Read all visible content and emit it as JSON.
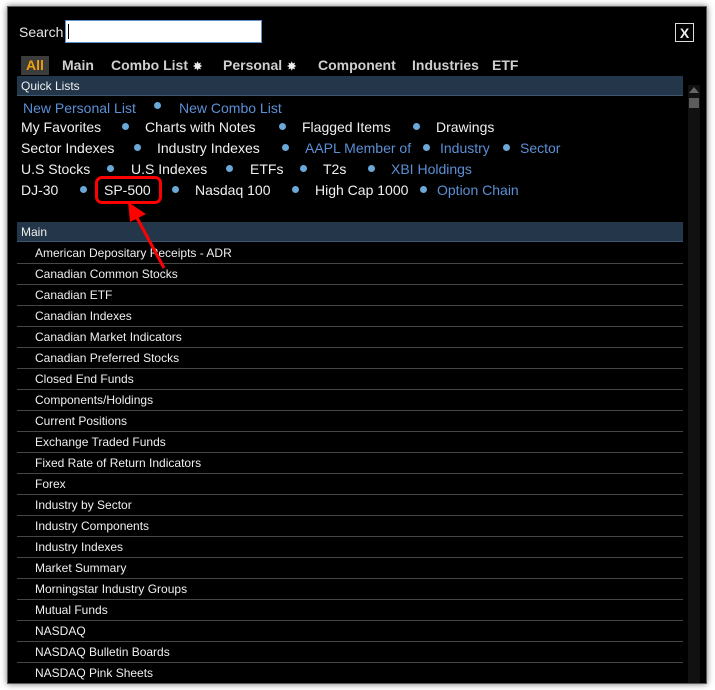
{
  "search": {
    "label": "Search",
    "value": ""
  },
  "close_label": "X",
  "tabs": [
    {
      "label": "All"
    },
    {
      "label": "Main"
    },
    {
      "label": "Combo List",
      "star": "✸"
    },
    {
      "label": "Personal",
      "star": "✸"
    },
    {
      "label": "Component"
    },
    {
      "label": "Industries"
    },
    {
      "label": "ETF"
    }
  ],
  "quick_lists": {
    "header": "Quick Lists",
    "rows": [
      [
        "New Personal List",
        "New Combo List"
      ],
      [
        "My Favorites",
        "Charts with Notes",
        "Flagged Items",
        "Drawings"
      ],
      [
        "Sector Indexes",
        "Industry Indexes",
        "AAPL Member of",
        "Industry",
        "Sector"
      ],
      [
        "U.S Stocks",
        "U.S Indexes",
        "ETFs",
        "T2s",
        "XBI Holdings"
      ],
      [
        "DJ-30",
        "SP-500",
        "Nasdaq 100",
        "High Cap 1000",
        "Option Chain"
      ]
    ]
  },
  "main_list": {
    "header": "Main",
    "items": [
      "American Depositary Receipts - ADR",
      "Canadian Common Stocks",
      "Canadian ETF",
      "Canadian Indexes",
      "Canadian Market Indicators",
      "Canadian Preferred Stocks",
      "Closed End Funds",
      "Components/Holdings",
      "Current Positions",
      "Exchange Traded Funds",
      "Fixed Rate of Return Indicators",
      "Forex",
      "Industry by Sector",
      "Industry Components",
      "Industry Indexes",
      "Market Summary",
      "Morningstar Industry Groups",
      "Mutual Funds",
      "NASDAQ",
      "NASDAQ Bulletin Boards",
      "NASDAQ Pink Sheets"
    ]
  },
  "colors": {
    "accent": "#f0a00a",
    "link": "#5b8fd6",
    "header_bg": "#24364a",
    "annotation": "#ff0000"
  }
}
